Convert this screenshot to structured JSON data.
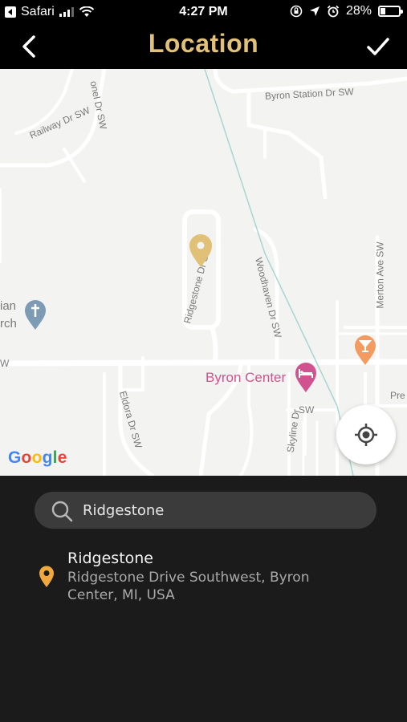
{
  "status_bar": {
    "carrier": "Safari",
    "time": "4:27 PM",
    "battery": "28%",
    "battery_level": 0.28,
    "icons": [
      "back-to-app-icon",
      "signal-icon",
      "wifi-icon",
      "screen-lock-icon",
      "location-arrow-icon",
      "alarm-icon",
      "battery-icon"
    ]
  },
  "nav": {
    "title": "Location",
    "back_icon": "chevron-left-icon",
    "done_icon": "checkmark-icon",
    "accent": "#e1c078"
  },
  "map": {
    "labels": {
      "byron_station": "Byron Station Dr SW",
      "railway": "Railway Dr SW",
      "colonel": "onel Dr SW",
      "ridgestone": "Ridgestone Dr SW",
      "woodhaven": "Woodhaven Dr SW",
      "merton": "Merton Ave SW",
      "eldora": "Eldora Dr SW",
      "skyline": "Skyline Dr",
      "sw_left": "W",
      "sw_mid": "SW",
      "church_a": "ian",
      "church_b": "rch",
      "pre": "Pre"
    },
    "poi_name": "Byron Center",
    "google_logo": [
      "G",
      "o",
      "o",
      "g",
      "l",
      "e"
    ],
    "google_colors": [
      "#4285f4",
      "#ea4335",
      "#fbbc05",
      "#4285f4",
      "#34a853",
      "#ea4335"
    ],
    "pin_color": "#e1c078",
    "poi_color": "#d0538f"
  },
  "search": {
    "value": "Ridgestone",
    "placeholder": "Search"
  },
  "results": [
    {
      "title": "Ridgestone",
      "address": "Ridgestone Drive Southwest, Byron Center, MI, USA",
      "pin_color": "#f2a93b"
    }
  ]
}
